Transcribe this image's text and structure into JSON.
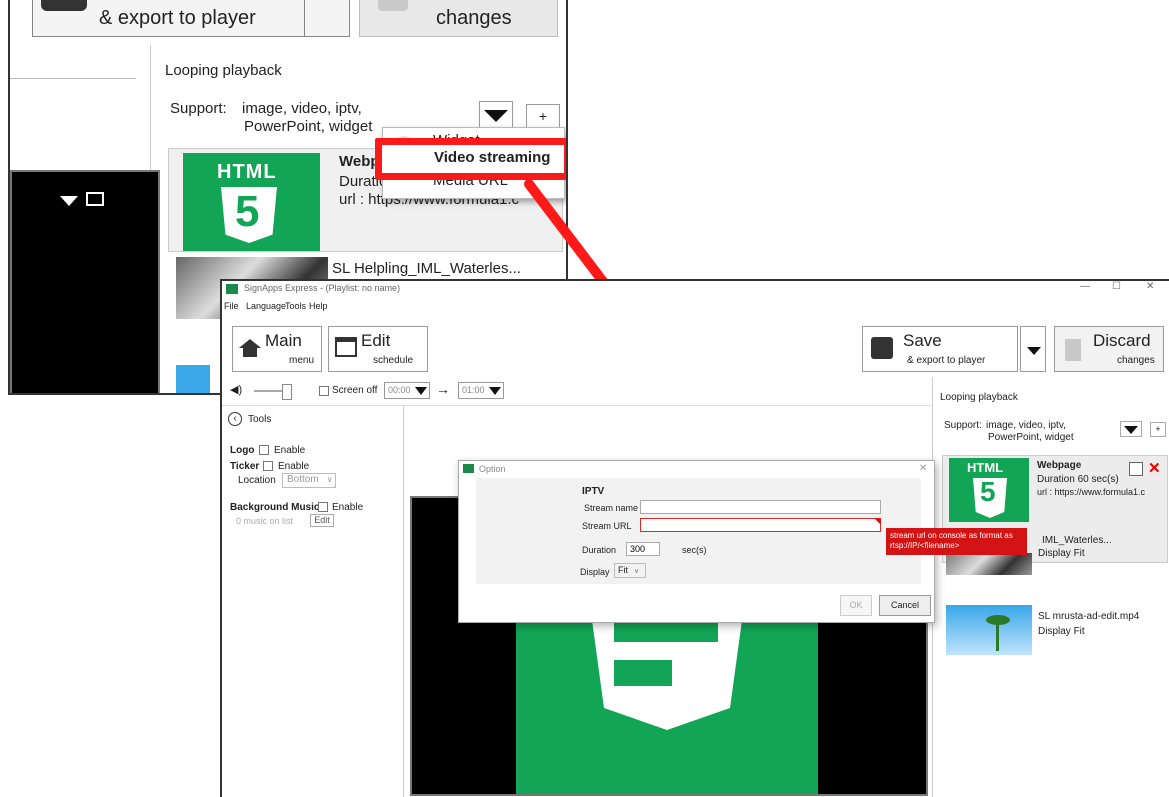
{
  "zoom": {
    "export_label": "& export to player",
    "discard_label": "changes",
    "looping": "Looping playback",
    "support_prefix": "Support:",
    "support_line1": "image, video, iptv,",
    "support_line2": "PowerPoint, widget",
    "add_symbol": "+",
    "dropdown": [
      "Widget",
      "Video streaming",
      "Media URL"
    ],
    "highlighted_item": "Video streaming",
    "item1_title": "Webp",
    "item1_duration": "Duratic",
    "item1_url": "url :  https://www.formula1.c",
    "item2_title": "SL Helpling_IML_Waterles...",
    "html_badge": "HTML",
    "five_glyph": "5"
  },
  "app": {
    "title": "SignApps Express - (Playlist: no name)",
    "win_controls": [
      "—",
      "☐",
      "✕"
    ],
    "menu": [
      "File",
      "Language",
      "Tools",
      "Help"
    ],
    "main_btn": {
      "label": "Main",
      "sub": "menu"
    },
    "edit_btn": {
      "label": "Edit",
      "sub": "schedule"
    },
    "save_btn": {
      "label": "Save",
      "sub": "& export to player"
    },
    "discard_btn": {
      "label": "Discard",
      "sub": "changes"
    },
    "screen_off": "Screen off",
    "time_from": "00:00",
    "time_to": "01:00",
    "arrow": "→",
    "tools_label": "Tools",
    "logo_label": "Logo",
    "ticker_label": "Ticker",
    "enable": "Enable",
    "location_label": "Location",
    "location_value": "Bottom",
    "bg_music_label": "Background Music",
    "music_on_list": "0  music on list",
    "edit_label": "Edit",
    "looping": "Looping playback",
    "support_prefix": "Support:",
    "support_line1": "image, video, iptv,",
    "support_line2": "PowerPoint, widget",
    "add_symbol": "+",
    "playlist": [
      {
        "title": "Webpage",
        "duration": "Duration  60 sec(s)",
        "url": "url :  https://www.formula1.c"
      },
      {
        "title": "IML_Waterles...",
        "display": "Display Fit"
      },
      {
        "title": "SL mrusta-ad-edit.mp4",
        "display": "Display Fit"
      }
    ],
    "html_badge": "HTML",
    "five_glyph": "5"
  },
  "dialog": {
    "title": "Option",
    "close": "✕",
    "section": "IPTV",
    "stream_name_label": "Stream name",
    "stream_name_value": "",
    "stream_url_label": "Stream URL",
    "stream_url_value": "",
    "duration_label": "Duration",
    "duration_value": "300",
    "duration_unit": "sec(s)",
    "display_label": "Display",
    "display_value": "Fit",
    "ok": "OK",
    "cancel": "Cancel",
    "error_tip": "stream url on console as format as rtsp://IP/<filename>"
  },
  "colors": {
    "highlight": "#ff1a1a",
    "html_green": "#12a556",
    "error_red": "#d41414"
  }
}
